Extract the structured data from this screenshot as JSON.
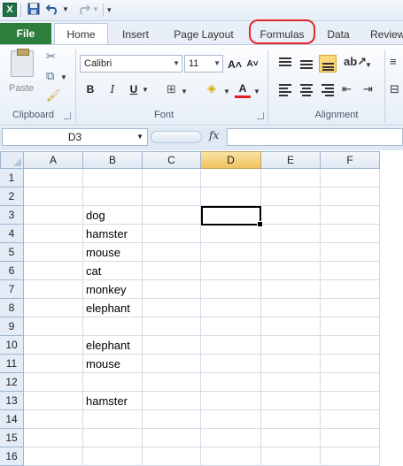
{
  "qat": {
    "app_icon": "X",
    "icons": [
      "excel-icon",
      "save-icon",
      "undo-icon",
      "redo-icon",
      "customize-icon"
    ]
  },
  "tabs": [
    {
      "label": "File"
    },
    {
      "label": "Home"
    },
    {
      "label": "Insert"
    },
    {
      "label": "Page Layout"
    },
    {
      "label": "Formulas"
    },
    {
      "label": "Data"
    },
    {
      "label": "Review"
    }
  ],
  "ribbon": {
    "clipboard": {
      "paste_label": "Paste",
      "group_label": "Clipboard"
    },
    "font": {
      "font_name": "Calibri",
      "font_size": "11",
      "group_label": "Font",
      "bold": "B",
      "italic": "I",
      "underline": "U",
      "grow": "A˄",
      "shrink": "A˅",
      "font_color_letter": "A"
    },
    "alignment": {
      "group_label": "Alignment"
    }
  },
  "formula_bar": {
    "name_box": "D3",
    "fx_label": "fx",
    "formula": ""
  },
  "columns": [
    "A",
    "B",
    "C",
    "D",
    "E",
    "F"
  ],
  "selected_column": "D",
  "rows": [
    {
      "num": "1",
      "b": ""
    },
    {
      "num": "2",
      "b": ""
    },
    {
      "num": "3",
      "b": "dog"
    },
    {
      "num": "4",
      "b": "hamster"
    },
    {
      "num": "5",
      "b": "mouse"
    },
    {
      "num": "6",
      "b": "cat"
    },
    {
      "num": "7",
      "b": "monkey"
    },
    {
      "num": "8",
      "b": "elephant"
    },
    {
      "num": "9",
      "b": ""
    },
    {
      "num": "10",
      "b": "elephant"
    },
    {
      "num": "11",
      "b": "mouse"
    },
    {
      "num": "12",
      "b": ""
    },
    {
      "num": "13",
      "b": "hamster"
    },
    {
      "num": "14",
      "b": ""
    },
    {
      "num": "15",
      "b": ""
    },
    {
      "num": "16",
      "b": ""
    }
  ],
  "active_cell": "D3",
  "colors": {
    "file_tab": "#2d7d3c",
    "highlight": "#e8262a",
    "selected_header": "#f1c15f"
  }
}
